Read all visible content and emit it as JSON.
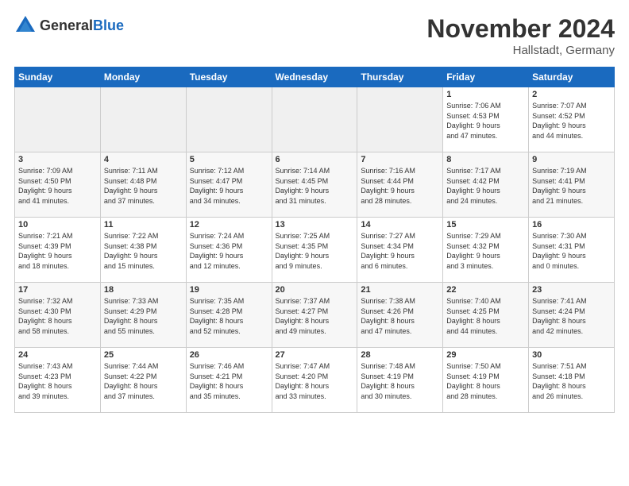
{
  "header": {
    "logo_line1": "General",
    "logo_line2": "Blue",
    "month_title": "November 2024",
    "location": "Hallstadt, Germany"
  },
  "days_of_week": [
    "Sunday",
    "Monday",
    "Tuesday",
    "Wednesday",
    "Thursday",
    "Friday",
    "Saturday"
  ],
  "weeks": [
    [
      {
        "day": "",
        "info": "",
        "empty": true
      },
      {
        "day": "",
        "info": "",
        "empty": true
      },
      {
        "day": "",
        "info": "",
        "empty": true
      },
      {
        "day": "",
        "info": "",
        "empty": true
      },
      {
        "day": "",
        "info": "",
        "empty": true
      },
      {
        "day": "1",
        "info": "Sunrise: 7:06 AM\nSunset: 4:53 PM\nDaylight: 9 hours\nand 47 minutes."
      },
      {
        "day": "2",
        "info": "Sunrise: 7:07 AM\nSunset: 4:52 PM\nDaylight: 9 hours\nand 44 minutes."
      }
    ],
    [
      {
        "day": "3",
        "info": "Sunrise: 7:09 AM\nSunset: 4:50 PM\nDaylight: 9 hours\nand 41 minutes."
      },
      {
        "day": "4",
        "info": "Sunrise: 7:11 AM\nSunset: 4:48 PM\nDaylight: 9 hours\nand 37 minutes."
      },
      {
        "day": "5",
        "info": "Sunrise: 7:12 AM\nSunset: 4:47 PM\nDaylight: 9 hours\nand 34 minutes."
      },
      {
        "day": "6",
        "info": "Sunrise: 7:14 AM\nSunset: 4:45 PM\nDaylight: 9 hours\nand 31 minutes."
      },
      {
        "day": "7",
        "info": "Sunrise: 7:16 AM\nSunset: 4:44 PM\nDaylight: 9 hours\nand 28 minutes."
      },
      {
        "day": "8",
        "info": "Sunrise: 7:17 AM\nSunset: 4:42 PM\nDaylight: 9 hours\nand 24 minutes."
      },
      {
        "day": "9",
        "info": "Sunrise: 7:19 AM\nSunset: 4:41 PM\nDaylight: 9 hours\nand 21 minutes."
      }
    ],
    [
      {
        "day": "10",
        "info": "Sunrise: 7:21 AM\nSunset: 4:39 PM\nDaylight: 9 hours\nand 18 minutes."
      },
      {
        "day": "11",
        "info": "Sunrise: 7:22 AM\nSunset: 4:38 PM\nDaylight: 9 hours\nand 15 minutes."
      },
      {
        "day": "12",
        "info": "Sunrise: 7:24 AM\nSunset: 4:36 PM\nDaylight: 9 hours\nand 12 minutes."
      },
      {
        "day": "13",
        "info": "Sunrise: 7:25 AM\nSunset: 4:35 PM\nDaylight: 9 hours\nand 9 minutes."
      },
      {
        "day": "14",
        "info": "Sunrise: 7:27 AM\nSunset: 4:34 PM\nDaylight: 9 hours\nand 6 minutes."
      },
      {
        "day": "15",
        "info": "Sunrise: 7:29 AM\nSunset: 4:32 PM\nDaylight: 9 hours\nand 3 minutes."
      },
      {
        "day": "16",
        "info": "Sunrise: 7:30 AM\nSunset: 4:31 PM\nDaylight: 9 hours\nand 0 minutes."
      }
    ],
    [
      {
        "day": "17",
        "info": "Sunrise: 7:32 AM\nSunset: 4:30 PM\nDaylight: 8 hours\nand 58 minutes."
      },
      {
        "day": "18",
        "info": "Sunrise: 7:33 AM\nSunset: 4:29 PM\nDaylight: 8 hours\nand 55 minutes."
      },
      {
        "day": "19",
        "info": "Sunrise: 7:35 AM\nSunset: 4:28 PM\nDaylight: 8 hours\nand 52 minutes."
      },
      {
        "day": "20",
        "info": "Sunrise: 7:37 AM\nSunset: 4:27 PM\nDaylight: 8 hours\nand 49 minutes."
      },
      {
        "day": "21",
        "info": "Sunrise: 7:38 AM\nSunset: 4:26 PM\nDaylight: 8 hours\nand 47 minutes."
      },
      {
        "day": "22",
        "info": "Sunrise: 7:40 AM\nSunset: 4:25 PM\nDaylight: 8 hours\nand 44 minutes."
      },
      {
        "day": "23",
        "info": "Sunrise: 7:41 AM\nSunset: 4:24 PM\nDaylight: 8 hours\nand 42 minutes."
      }
    ],
    [
      {
        "day": "24",
        "info": "Sunrise: 7:43 AM\nSunset: 4:23 PM\nDaylight: 8 hours\nand 39 minutes."
      },
      {
        "day": "25",
        "info": "Sunrise: 7:44 AM\nSunset: 4:22 PM\nDaylight: 8 hours\nand 37 minutes."
      },
      {
        "day": "26",
        "info": "Sunrise: 7:46 AM\nSunset: 4:21 PM\nDaylight: 8 hours\nand 35 minutes."
      },
      {
        "day": "27",
        "info": "Sunrise: 7:47 AM\nSunset: 4:20 PM\nDaylight: 8 hours\nand 33 minutes."
      },
      {
        "day": "28",
        "info": "Sunrise: 7:48 AM\nSunset: 4:19 PM\nDaylight: 8 hours\nand 30 minutes."
      },
      {
        "day": "29",
        "info": "Sunrise: 7:50 AM\nSunset: 4:19 PM\nDaylight: 8 hours\nand 28 minutes."
      },
      {
        "day": "30",
        "info": "Sunrise: 7:51 AM\nSunset: 4:18 PM\nDaylight: 8 hours\nand 26 minutes."
      }
    ]
  ]
}
